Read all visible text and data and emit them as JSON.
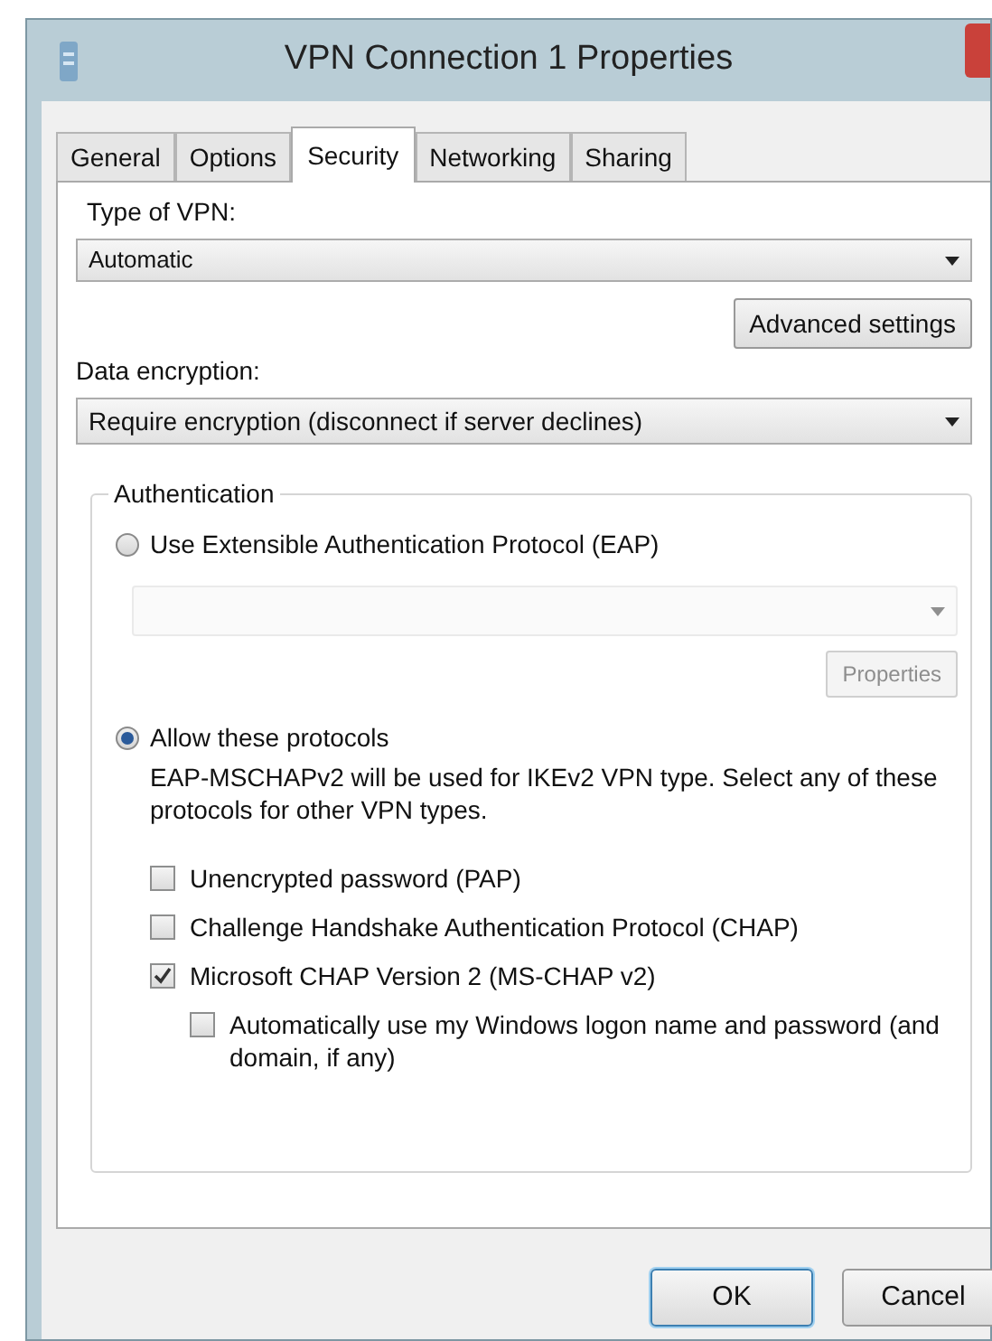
{
  "window": {
    "title": "VPN Connection 1 Properties"
  },
  "tabs": [
    {
      "label": "General",
      "selected": false
    },
    {
      "label": "Options",
      "selected": false
    },
    {
      "label": "Security",
      "selected": true
    },
    {
      "label": "Networking",
      "selected": false
    },
    {
      "label": "Sharing",
      "selected": false
    }
  ],
  "type_of_vpn": {
    "label": "Type of VPN:",
    "value": "Automatic"
  },
  "advanced_button": "Advanced settings",
  "data_encryption": {
    "label": "Data encryption:",
    "value": "Require encryption (disconnect if server declines)"
  },
  "authentication": {
    "title": "Authentication",
    "eap_option": {
      "label": "Use Extensible Authentication Protocol (EAP)",
      "selected": false
    },
    "eap_dropdown": {
      "disabled": true
    },
    "properties_button": {
      "label": "Properties",
      "disabled": true
    },
    "protocols_option": {
      "label": "Allow these protocols",
      "selected": true
    },
    "description": "EAP-MSCHAPv2 will be used for IKEv2 VPN type. Select any of these protocols for other VPN types.",
    "protocols": [
      {
        "label": "Unencrypted password (PAP)",
        "checked": false
      },
      {
        "label": "Challenge Handshake Authentication Protocol (CHAP)",
        "checked": false
      },
      {
        "label": "Microsoft CHAP Version 2 (MS-CHAP v2)",
        "checked": true,
        "children": [
          {
            "label": "Automatically use my Windows logon name and password (and domain, if any)",
            "checked": false
          }
        ]
      }
    ]
  },
  "buttons": [
    "OK",
    "Cancel"
  ]
}
